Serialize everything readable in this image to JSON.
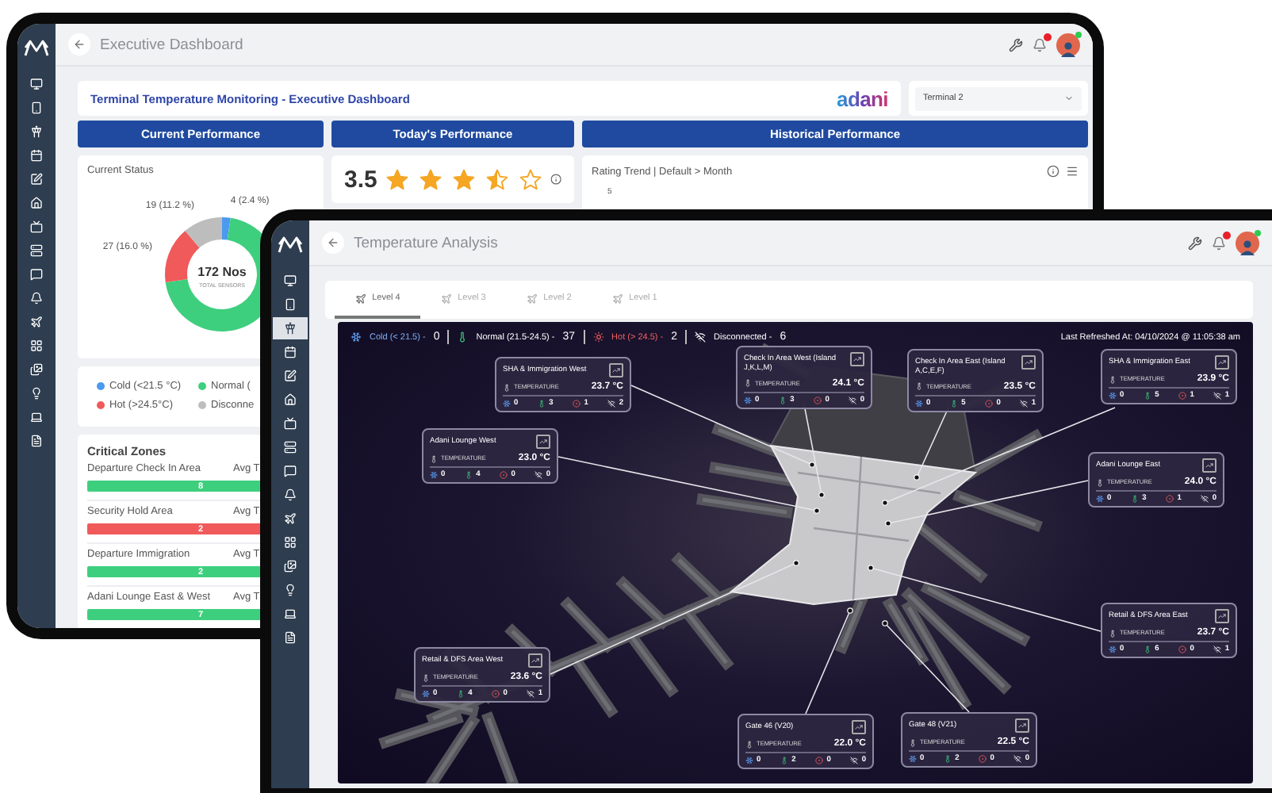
{
  "back_window": {
    "title": "Executive Dashboard",
    "sidebar": [
      {
        "selected": false
      },
      {
        "selected": false
      },
      {
        "selected": false
      },
      {
        "selected": false
      },
      {
        "selected": false
      },
      {
        "selected": false
      },
      {
        "selected": false
      },
      {
        "selected": false
      },
      {
        "selected": false
      },
      {
        "selected": false
      },
      {
        "selected": false
      },
      {
        "selected": false
      },
      {
        "selected": false
      },
      {
        "selected": false
      },
      {
        "selected": false
      },
      {
        "selected": false
      }
    ],
    "banner": {
      "title": "Terminal Temperature Monitoring - Executive Dashboard",
      "logo": "adani",
      "terminal": "Terminal 2"
    },
    "sections": [
      "Current Performance",
      "Today's Performance",
      "Historical Performance"
    ],
    "current_status": {
      "title": "Current Status",
      "total": "172 Nos",
      "total_label": "TOTAL SENSORS",
      "chart_data": {
        "type": "donut",
        "values": [
          2.4,
          70.4,
          16.0,
          11.2
        ],
        "value_labels": [
          "4 (2.4 %)",
          null,
          "27 (16.0 %)",
          "19 (11.2 %)"
        ]
      }
    },
    "todays_performance": {
      "score": "3.5",
      "stars": 3.5
    },
    "historical_performance": {
      "title": "Rating Trend | Default > Month",
      "axis_label": "5"
    },
    "legend": [
      {
        "label": "Cold (<21.5 °C)",
        "color": "#4a9af0"
      },
      {
        "label": "Normal (",
        "color": "#3ecf7e"
      },
      {
        "label": "Hot (>24.5°C)",
        "color": "#f05a5a"
      },
      {
        "label": "Disconne",
        "color": "#bdbdbd"
      }
    ],
    "critical_zones": {
      "title": "Critical Zones",
      "zones": [
        {
          "name": "Departure Check In Area",
          "metric": "Avg T",
          "count": "8",
          "color": "#3ecf7e"
        },
        {
          "name": "Security Hold Area",
          "metric": "Avg T",
          "count": "2",
          "color": "#f05a5a"
        },
        {
          "name": "Departure Immigration",
          "metric": "Avg T",
          "count": "2",
          "color": "#3ecf7e"
        },
        {
          "name": "Adani Lounge East & West",
          "metric": "Avg T",
          "count": "7",
          "color": "#3ecf7e"
        }
      ]
    }
  },
  "front_window": {
    "title": "Temperature Analysis",
    "sidebar": [
      {
        "selected": false
      },
      {
        "selected": false
      },
      {
        "selected": true
      },
      {
        "selected": false
      },
      {
        "selected": false
      },
      {
        "selected": false
      },
      {
        "selected": false
      },
      {
        "selected": false
      },
      {
        "selected": false
      },
      {
        "selected": false
      },
      {
        "selected": false
      },
      {
        "selected": false
      },
      {
        "selected": false
      },
      {
        "selected": false
      },
      {
        "selected": false
      },
      {
        "selected": false
      }
    ],
    "tabs": [
      {
        "label": "Level 4",
        "selected": true
      },
      {
        "label": "Level 3",
        "selected": false
      },
      {
        "label": "Level 2",
        "selected": false
      },
      {
        "label": "Level 1",
        "selected": false
      }
    ],
    "summary": [
      {
        "kind": "cold",
        "label": "Cold (< 21.5) -",
        "value": "0"
      },
      {
        "kind": "normal",
        "label": "Normal (21.5-24.5) -",
        "value": "37"
      },
      {
        "kind": "hot",
        "label": "Hot (> 24.5) -",
        "value": "2"
      },
      {
        "kind": "disconnected",
        "label": "Disconnected -",
        "value": "6"
      }
    ],
    "last_refreshed": "Last Refreshed At: 04/10/2024 @ 11:05:38 am",
    "zones": [
      {
        "name": "SHA & Immigration West",
        "metric": "TEMPERATURE",
        "value": "23.7 °C",
        "counts": [
          "0",
          "3",
          "1",
          "2"
        ]
      },
      {
        "name": "Check In Area West (Island J,K,L,M)",
        "metric": "TEMPERATURE",
        "value": "24.1 °C",
        "counts": [
          "0",
          "3",
          "0",
          "0"
        ]
      },
      {
        "name": "Check In Area East (Island A,C,E,F)",
        "metric": "TEMPERATURE",
        "value": "23.5 °C",
        "counts": [
          "0",
          "5",
          "0",
          "1"
        ]
      },
      {
        "name": "SHA & Immigration East",
        "metric": "TEMPERATURE",
        "value": "23.9 °C",
        "counts": [
          "0",
          "5",
          "1",
          "1"
        ]
      },
      {
        "name": "Adani Lounge West",
        "metric": "TEMPERATURE",
        "value": "23.0 °C",
        "counts": [
          "0",
          "4",
          "0",
          "0"
        ]
      },
      {
        "name": "Adani Lounge East",
        "metric": "TEMPERATURE",
        "value": "24.0 °C",
        "counts": [
          "0",
          "3",
          "1",
          "0"
        ]
      },
      {
        "name": "Retail & DFS Area East",
        "metric": "TEMPERATURE",
        "value": "23.7 °C",
        "counts": [
          "0",
          "6",
          "0",
          "1"
        ]
      },
      {
        "name": "Retail & DFS Area West",
        "metric": "TEMPERATURE",
        "value": "23.6 °C",
        "counts": [
          "0",
          "4",
          "0",
          "1"
        ]
      },
      {
        "name": "Gate 46 (V20)",
        "metric": "TEMPERATURE",
        "value": "22.0 °C",
        "counts": [
          "0",
          "2",
          "0",
          "0"
        ]
      },
      {
        "name": "Gate 48 (V21)",
        "metric": "TEMPERATURE",
        "value": "22.5 °C",
        "counts": [
          "0",
          "2",
          "0",
          "0"
        ]
      }
    ]
  }
}
